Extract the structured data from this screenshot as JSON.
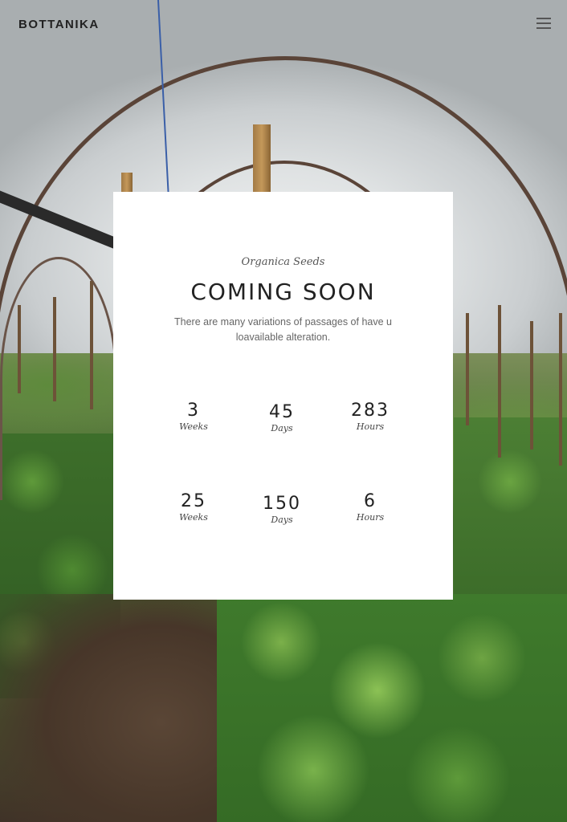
{
  "header": {
    "brand": "BOTTANIKA",
    "menu_icon": "hamburger-menu-icon"
  },
  "card": {
    "subtitle": "Organica Seeds",
    "title": "COMING SOON",
    "description": "There are many variations of passages of have u loavailable alteration.",
    "countdown": [
      {
        "value": "3",
        "label": "Weeks"
      },
      {
        "value": "45",
        "label": "Days"
      },
      {
        "value": "283",
        "label": "Hours"
      },
      {
        "value": "25",
        "label": "Weeks"
      },
      {
        "value": "150",
        "label": "Days"
      },
      {
        "value": "6",
        "label": "Hours"
      }
    ]
  }
}
